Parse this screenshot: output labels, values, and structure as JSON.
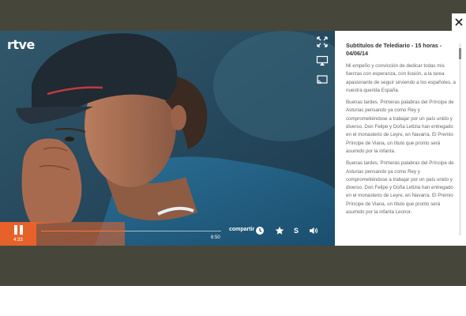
{
  "player": {
    "logo_text": "rtve",
    "current_time": "4:33",
    "duration": "6:50",
    "progress_fraction": 0.37,
    "share_label": "compartir",
    "speed_label": "S",
    "colors": {
      "accent": "#f06428",
      "overlay": "#47463b",
      "panel": "#ffffff"
    }
  },
  "icons": {
    "close": "close-icon",
    "fullscreen": "fullscreen-icon",
    "airplay": "airplay-icon",
    "cast": "cast-icon",
    "pause": "pause-icon",
    "clock": "clock-icon",
    "star": "star-icon",
    "volume": "volume-icon"
  },
  "subtitles": {
    "title": "Subtítulos de Telediario - 15 horas - 04/06/14",
    "paragraphs": [
      "Mi empeño y convicción de dedicar todas mis fuerzas con esperanza, con ilusión, a la tarea apasionante de seguir sirviendo a los españoles, a nuestra querida España.",
      "Buenas tardes. Primeras palabras del Príncipe de Asturias pensando ya como Rey y comprometiéndose a trabajar por un país unido y diverso. Don Felipe y Doña Letizia han entregado en el monasterio de Leyre, en Navarra. El Premio Príncipe de Viana, un título que pronto será asumido por la infanta.",
      "Buenas tardes. Primeras palabras del Príncipe de Asturias pensando ya como Rey y comprometiéndose a trabajar por un país unido y diverso. Don Felipe y Doña Letizia han entregado en el monasterio de Leyre, en Navarra. El Premio Príncipe de Viana, un título que pronto será asumido por la infanta Leonor."
    ]
  }
}
